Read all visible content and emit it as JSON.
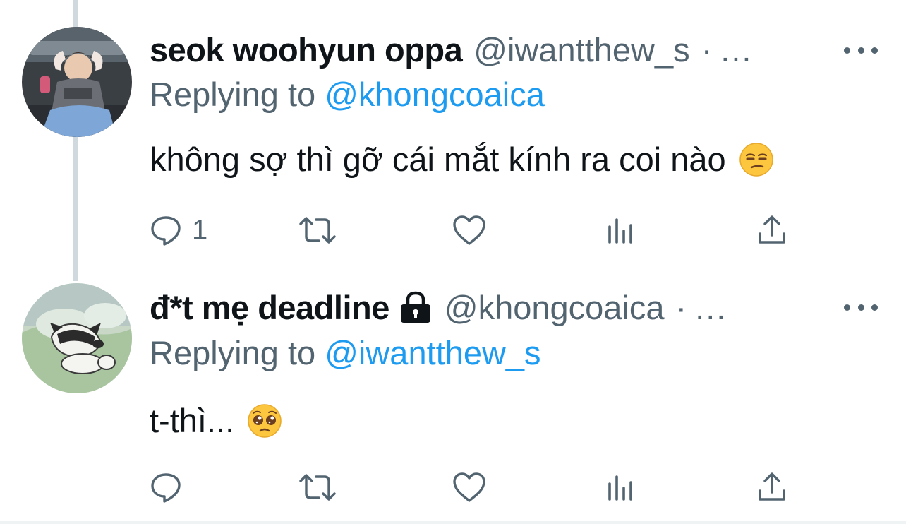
{
  "tweets": [
    {
      "display_name": "seok woohyun oppa",
      "handle": "@iwantthew_s",
      "separator": "·",
      "truncation": "...",
      "replying_to_prefix": "Replying to",
      "replying_to_mention": "@khongcoaica",
      "text": "không sợ thì gỡ cái mắt kính ra coi nào",
      "emoji": "unamused-face",
      "reply_count": "1",
      "locked": false
    },
    {
      "display_name": "đ*t mẹ deadline",
      "handle": "@khongcoaica",
      "separator": "·",
      "truncation": "...",
      "replying_to_prefix": "Replying to",
      "replying_to_mention": "@iwantthew_s",
      "text": "t-thì...",
      "emoji": "pleading-face",
      "reply_count": "",
      "locked": true
    }
  ],
  "icons": {
    "reply": "speech-bubble-icon",
    "retweet": "retweet-icon",
    "like": "heart-icon",
    "views": "bar-chart-icon",
    "share": "share-icon",
    "more": "more-dots-icon",
    "lock": "lock-icon"
  },
  "colors": {
    "text": "#0f1419",
    "secondary": "#536471",
    "link": "#1d9bf0",
    "thread_line": "#cfd9de",
    "divider": "#eff3f4"
  }
}
